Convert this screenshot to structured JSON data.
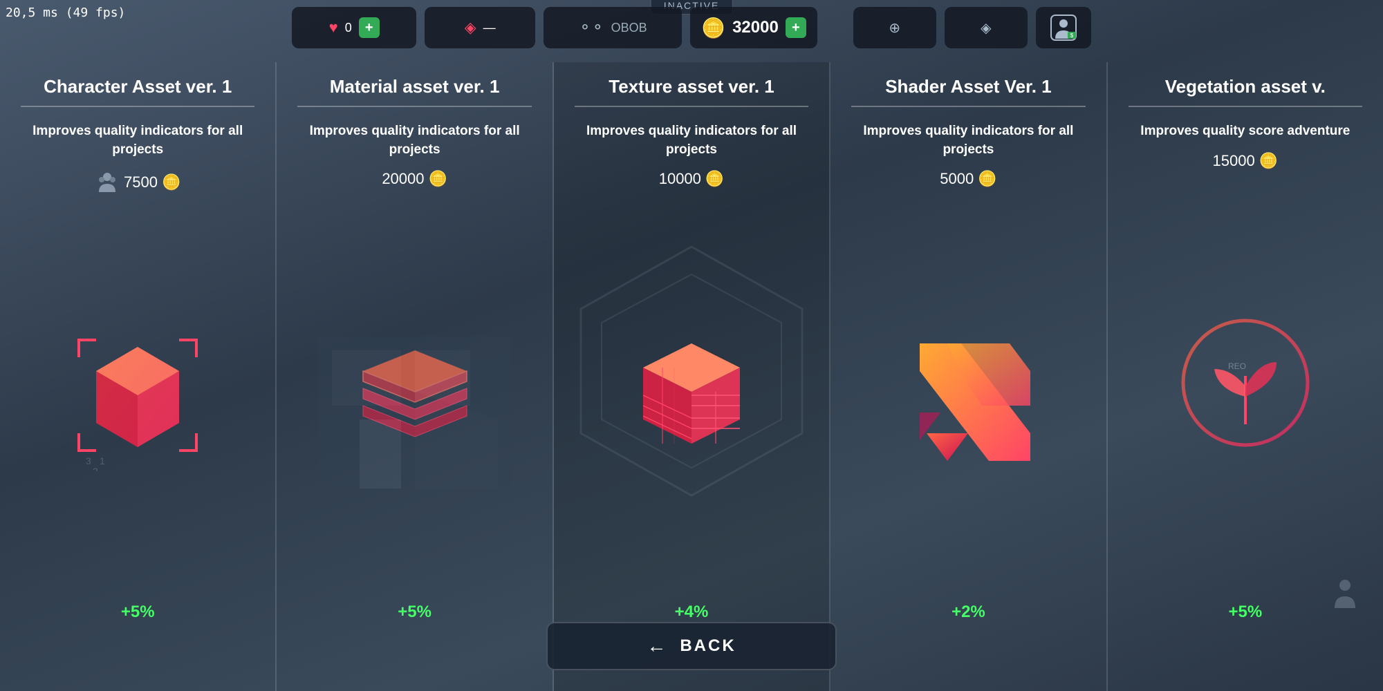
{
  "perf": {
    "label": "20,5 ms (49 fps)"
  },
  "topbar": {
    "heart_count": "0",
    "add_label": "+",
    "layers_dash": "—",
    "dots_text": "OBOB",
    "currency_amount": "32000",
    "currency_add": "+",
    "inactive_label": "INACTIVE",
    "back_label": "BACK"
  },
  "cards": [
    {
      "id": "character",
      "title": "Character Asset ver. 1",
      "description": "Improves quality indicators for all projects",
      "cost": "7500",
      "bonus": "+5%"
    },
    {
      "id": "material",
      "title": "Material asset ver. 1",
      "description": "Improves quality indicators for all projects",
      "cost": "20000",
      "bonus": "+5%"
    },
    {
      "id": "texture",
      "title": "Texture asset ver. 1",
      "description": "Improves quality indicators for all projects",
      "cost": "10000",
      "bonus": "+4%"
    },
    {
      "id": "shader",
      "title": "Shader Asset Ver. 1",
      "description": "Improves quality indicators for all projects",
      "cost": "5000",
      "bonus": "+2%"
    },
    {
      "id": "vegetation",
      "title": "Vegetation asset v.",
      "description": "Improves quality score adventure",
      "cost": "15000",
      "bonus": "+5%"
    }
  ]
}
